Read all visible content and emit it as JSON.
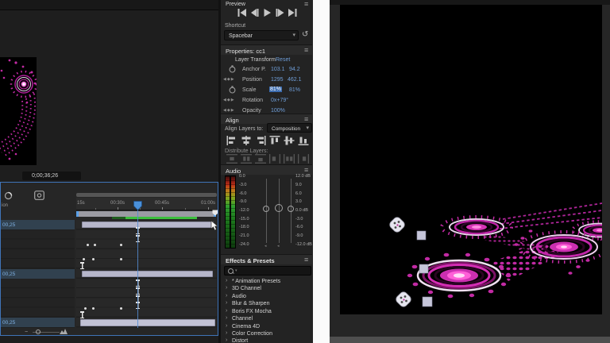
{
  "left": {
    "current_time": "0;00;36;26",
    "timeline": {
      "left_header_fragment": "ion",
      "ruler_labels": [
        "15s",
        "00:30s",
        "00:45s",
        "01:00s"
      ],
      "row_durations": [
        "00,25",
        "00,25",
        "00,25"
      ]
    }
  },
  "preview": {
    "title": "Preview"
  },
  "shortcut": {
    "label": "Shortcut",
    "value": "Spacebar"
  },
  "properties": {
    "title": "Properties: cc1",
    "group_label": "Layer Transform",
    "reset_label": "Reset",
    "rows": [
      {
        "label": "Anchor P.",
        "v1": "103.1",
        "v2": "94.2"
      },
      {
        "label": "Position",
        "v1": "1295",
        "v2": "462.1"
      },
      {
        "label": "Scale",
        "v1": "81%",
        "v2": "81%"
      },
      {
        "label": "Rotation",
        "v1": "0x+79°",
        "v2": ""
      },
      {
        "label": "Opacity",
        "v1": "100%",
        "v2": ""
      }
    ]
  },
  "align": {
    "title": "Align",
    "align_to_label": "Align Layers to:",
    "align_to_value": "Composition",
    "distribute_label": "Distribute Layers:"
  },
  "audio": {
    "title": "Audio",
    "left_scale": [
      "0.0",
      "-3.0",
      "-6.0",
      "-9.0",
      "-12.0",
      "-15.0",
      "-18.0",
      "-21.0",
      "-24.0"
    ],
    "right_scale": [
      "12.0 dB",
      "9.0",
      "6.0",
      "3.0",
      "0.0 dB",
      "-3.0",
      "-6.0",
      "-9.0",
      "-12.0 dB"
    ]
  },
  "effects": {
    "title": "Effects & Presets",
    "items": [
      "* Animation Presets",
      "3D Channel",
      "Audio",
      "Blur & Sharpen",
      "Boris FX Mocha",
      "Channel",
      "Cinema 4D",
      "Color Correction",
      "Distort"
    ]
  },
  "colors": {
    "accent_blue": "#4a90d9",
    "value_blue": "#6f9ed8",
    "magenta": "#cc2fae",
    "render_green": "#3cbf3c",
    "layer_bar": "#b7b7cb"
  }
}
